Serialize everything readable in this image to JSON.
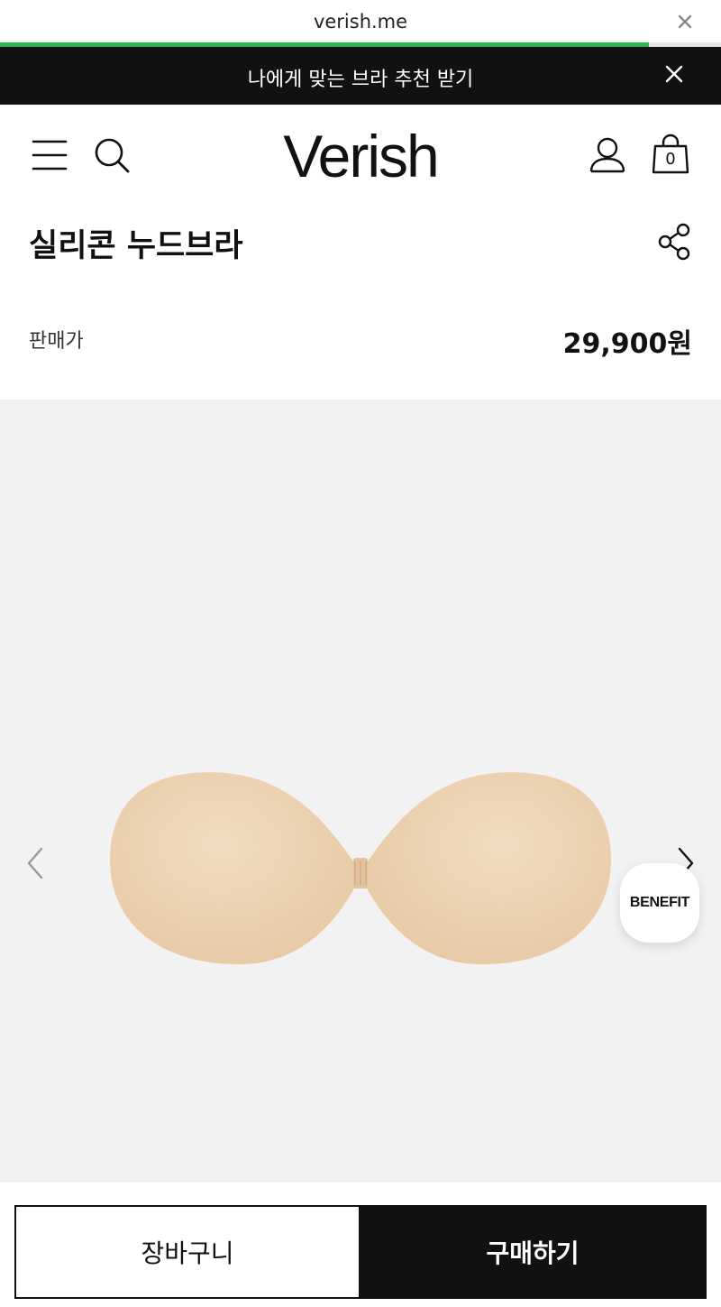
{
  "browser": {
    "url": "verish.me",
    "load_progress": 0.9,
    "close_icon": "close-icon"
  },
  "promo_banner": {
    "text": "나에게 맞는 브라 추천 받기",
    "close_icon": "close-icon"
  },
  "header": {
    "logo": "Verish",
    "menu_icon": "menu-icon",
    "search_icon": "search-icon",
    "account_icon": "user-icon",
    "cart_icon": "shopping-bag-icon",
    "cart_count": "0"
  },
  "product": {
    "title": "실리콘 누드브라",
    "share_icon": "share-icon",
    "price_label": "판매가",
    "price": "29,900원"
  },
  "gallery": {
    "prev_icon": "chevron-left-icon",
    "next_icon": "chevron-right-icon",
    "benefit_label": "BENEFIT",
    "background": "#f2f2f2",
    "product_color": "#ecd3b3"
  },
  "actions": {
    "cart_label": "장바구니",
    "buy_label": "구매하기"
  },
  "colors": {
    "accent": "#2fb552",
    "dark": "#111111"
  }
}
